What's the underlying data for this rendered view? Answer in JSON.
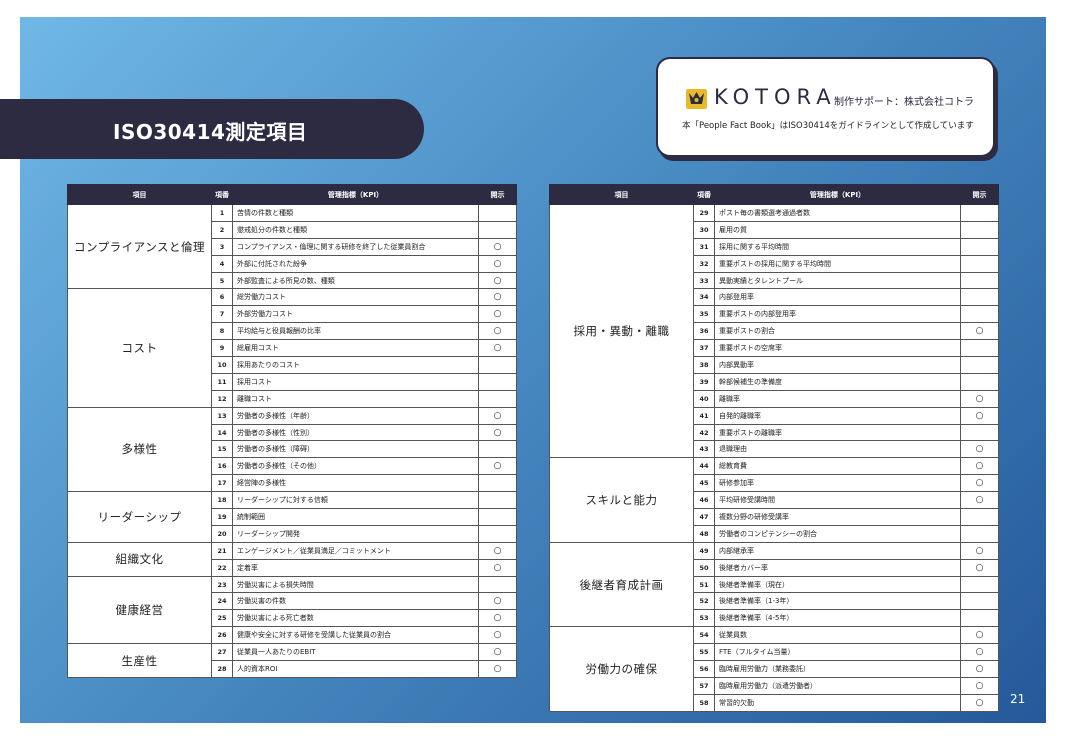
{
  "title": "ISO30414測定項目",
  "brand": {
    "name": "KOTORA",
    "support": "制作サポート：株式会社コトラ",
    "note": "本「People Fact Book」はISO30414をガイドラインとして作成しています"
  },
  "headers": {
    "category": "項目",
    "number": "項番",
    "kpi": "管理指標（KPI）",
    "disclosure": "開示"
  },
  "disclosure_mark": "○",
  "left_table": [
    {
      "category": "コンプライアンスと倫理",
      "items": [
        {
          "no": "1",
          "kpi": "苦情の件数と種類",
          "disclosed": false
        },
        {
          "no": "2",
          "kpi": "懲戒処分の件数と種類",
          "disclosed": false
        },
        {
          "no": "3",
          "kpi": "コンプライアンス・倫理に関する研修を終了した従業員割合",
          "disclosed": true
        },
        {
          "no": "4",
          "kpi": "外部に付託された紛争",
          "disclosed": true
        },
        {
          "no": "5",
          "kpi": "外部監査による所見の数、種類",
          "disclosed": true
        }
      ]
    },
    {
      "category": "コスト",
      "items": [
        {
          "no": "6",
          "kpi": "総労働力コスト",
          "disclosed": true
        },
        {
          "no": "7",
          "kpi": "外部労働力コスト",
          "disclosed": true
        },
        {
          "no": "8",
          "kpi": "平均給与と役員報酬の比率",
          "disclosed": true
        },
        {
          "no": "9",
          "kpi": "総雇用コスト",
          "disclosed": true
        },
        {
          "no": "10",
          "kpi": "採用あたりのコスト",
          "disclosed": false
        },
        {
          "no": "11",
          "kpi": "採用コスト",
          "disclosed": false
        },
        {
          "no": "12",
          "kpi": "離職コスト",
          "disclosed": false
        }
      ]
    },
    {
      "category": "多様性",
      "items": [
        {
          "no": "13",
          "kpi": "労働者の多様性（年齢）",
          "disclosed": true
        },
        {
          "no": "14",
          "kpi": "労働者の多様性（性別）",
          "disclosed": true
        },
        {
          "no": "15",
          "kpi": "労働者の多様性（障碍）",
          "disclosed": false
        },
        {
          "no": "16",
          "kpi": "労働者の多様性（その他）",
          "disclosed": true
        },
        {
          "no": "17",
          "kpi": "経営陣の多様性",
          "disclosed": false
        }
      ]
    },
    {
      "category": "リーダーシップ",
      "items": [
        {
          "no": "18",
          "kpi": "リーダーシップに対する信頼",
          "disclosed": false
        },
        {
          "no": "19",
          "kpi": "統制範囲",
          "disclosed": false
        },
        {
          "no": "20",
          "kpi": "リーダーシップ開発",
          "disclosed": false
        }
      ]
    },
    {
      "category": "組織文化",
      "items": [
        {
          "no": "21",
          "kpi": "エンゲージメント／従業員満足／コミットメント",
          "disclosed": true
        },
        {
          "no": "22",
          "kpi": "定着率",
          "disclosed": true
        }
      ]
    },
    {
      "category": "健康経営",
      "items": [
        {
          "no": "23",
          "kpi": "労働災害による損失時間",
          "disclosed": false
        },
        {
          "no": "24",
          "kpi": "労働災害の件数",
          "disclosed": true
        },
        {
          "no": "25",
          "kpi": "労働災害による死亡者数",
          "disclosed": true
        },
        {
          "no": "26",
          "kpi": "健康や安全に対する研修を受講した従業員の割合",
          "disclosed": true
        }
      ]
    },
    {
      "category": "生産性",
      "items": [
        {
          "no": "27",
          "kpi": "従業員一人あたりのEBIT",
          "disclosed": true
        },
        {
          "no": "28",
          "kpi": "人的資本ROI",
          "disclosed": true
        }
      ]
    }
  ],
  "right_table": [
    {
      "category": "採用・異動・離職",
      "items": [
        {
          "no": "29",
          "kpi": "ポスト毎の書類選考通過者数",
          "disclosed": false
        },
        {
          "no": "30",
          "kpi": "雇用の質",
          "disclosed": false
        },
        {
          "no": "31",
          "kpi": "採用に関する平均時間",
          "disclosed": false
        },
        {
          "no": "32",
          "kpi": "重要ポストの採用に関する平均時間",
          "disclosed": false
        },
        {
          "no": "33",
          "kpi": "異動実績とタレントプール",
          "disclosed": false
        },
        {
          "no": "34",
          "kpi": "内部登用率",
          "disclosed": false
        },
        {
          "no": "35",
          "kpi": "重要ポストの内部登用率",
          "disclosed": false
        },
        {
          "no": "36",
          "kpi": "重要ポストの割合",
          "disclosed": true
        },
        {
          "no": "37",
          "kpi": "重要ポストの空席率",
          "disclosed": false
        },
        {
          "no": "38",
          "kpi": "内部異動率",
          "disclosed": false
        },
        {
          "no": "39",
          "kpi": "幹部候補生の準備度",
          "disclosed": false
        },
        {
          "no": "40",
          "kpi": "離職率",
          "disclosed": true
        },
        {
          "no": "41",
          "kpi": "自発的離職率",
          "disclosed": true
        },
        {
          "no": "42",
          "kpi": "重要ポストの離職率",
          "disclosed": false
        },
        {
          "no": "43",
          "kpi": "退職理由",
          "disclosed": true
        }
      ]
    },
    {
      "category": "スキルと能力",
      "items": [
        {
          "no": "44",
          "kpi": "総教育費",
          "disclosed": true
        },
        {
          "no": "45",
          "kpi": "研修参加率",
          "disclosed": true
        },
        {
          "no": "46",
          "kpi": "平均研修受講時間",
          "disclosed": true
        },
        {
          "no": "47",
          "kpi": "複数分野の研修受講率",
          "disclosed": false
        },
        {
          "no": "48",
          "kpi": "労働者のコンピテンシーの割合",
          "disclosed": false
        }
      ]
    },
    {
      "category": "後継者育成計画",
      "items": [
        {
          "no": "49",
          "kpi": "内部継承率",
          "disclosed": true
        },
        {
          "no": "50",
          "kpi": "後継者カバー率",
          "disclosed": true
        },
        {
          "no": "51",
          "kpi": "後継者準備率（現在）",
          "disclosed": false
        },
        {
          "no": "52",
          "kpi": "後継者準備率（1-3年）",
          "disclosed": false
        },
        {
          "no": "53",
          "kpi": "後継者準備率（4-5年）",
          "disclosed": false
        }
      ]
    },
    {
      "category": "労働力の確保",
      "items": [
        {
          "no": "54",
          "kpi": "従業員数",
          "disclosed": true
        },
        {
          "no": "55",
          "kpi": "FTE（フルタイム当量）",
          "disclosed": true
        },
        {
          "no": "56",
          "kpi": "臨時雇用労働力（業務委託）",
          "disclosed": true
        },
        {
          "no": "57",
          "kpi": "臨時雇用労働力（派遣労働者）",
          "disclosed": true
        },
        {
          "no": "58",
          "kpi": "常習的欠勤",
          "disclosed": true
        }
      ]
    }
  ],
  "page_number": "21"
}
